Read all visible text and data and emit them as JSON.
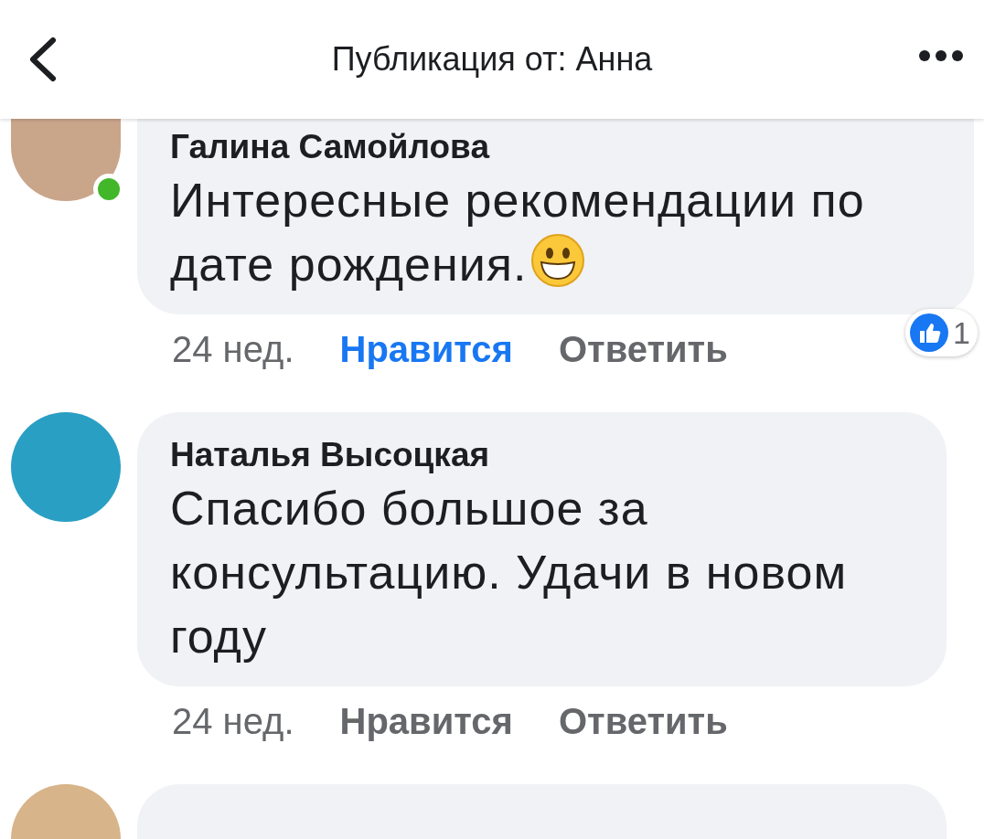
{
  "header": {
    "title": "Публикация от: Анна"
  },
  "comments": [
    {
      "name": "Галина Самойлова",
      "text": "Интересные рекомендации по дате рождения.",
      "emoji": true,
      "online": true,
      "time": "24 нед.",
      "like_label": "Нравится",
      "liked": true,
      "reply_label": "Ответить",
      "reaction_count": "1"
    },
    {
      "name": "Наталья Высоцкая",
      "text": "Спасибо большое за консультацию. Удачи в новом году",
      "emoji": false,
      "online": false,
      "time": "24 нед.",
      "like_label": "Нравится",
      "liked": false,
      "reply_label": "Ответить"
    }
  ]
}
